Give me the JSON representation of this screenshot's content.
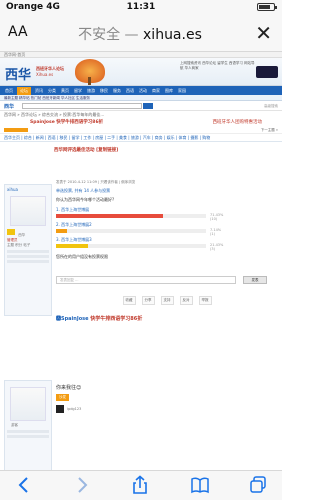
{
  "status_bar": {
    "carrier": "Orange  4G",
    "time": "11:31",
    "battery_level": 0.8
  },
  "safari": {
    "aa_label": "AA",
    "url_prefix": "不安全 — ",
    "url_domain": "xihua.es",
    "close_icon": "close-icon"
  },
  "site": {
    "topstrip": "西华网·首页",
    "logo": "西华",
    "logo_sub": "西班牙华人论坛",
    "logo_sub2": "Xihua.es",
    "banner_links": "上网搜索资讯  西华论坛  留学生  西语学习  网站导航  华人商家",
    "nav": [
      "首页",
      "论坛",
      "资讯",
      "分类",
      "黄页",
      "留学",
      "旅游",
      "移民",
      "服务",
      "西语",
      "活动",
      "商家",
      "图库",
      "家园"
    ],
    "subnav": "最新主题  精华帖  热门帖  西班牙新闻  华人社区  生活服务",
    "search_brand": "西华",
    "search_right": "高级搜索"
  },
  "breadcrumb": "西华网 » 西华论坛 » 综合交流 » 投票:西华每年的最佳…",
  "ads": {
    "left": "SpainJose 快学牛排西语学习86折",
    "right": "西班牙华人团购特惠活动"
  },
  "pager_right": "下一主题 »",
  "category_links": "西华主页 | 综合 | 新闻 | 西语 | 移民 | 留学 | 工作 | 房屋 | 二手 | 美食 | 旅游 | 汽车 | 商务 | 娱乐 | 体育 | 摄影 | 购物",
  "thread": {
    "title": "西华网评选最佳活动 [复制链接]",
    "meta": "发表于 2010-4-12 11:09 | 只看该作者 | 倒序浏览",
    "poll_title": "单选投票, 共有 14 人参与投票",
    "question": "你认为西华网今年哪个活动最好?",
    "options": [
      {
        "label": "1. 西华上海世博展",
        "percent": 71.43,
        "votes": 10,
        "color": "#e74c3c",
        "value_text": "71.43% (10)"
      },
      {
        "label": "2. 西华上海世博展2",
        "percent": 7.14,
        "votes": 1,
        "color": "#f39c12",
        "value_text": "7.14% (1)"
      },
      {
        "label": "3. 西华上海世博展3",
        "percent": 21.43,
        "votes": 3,
        "color": "#f1c40f",
        "value_text": "21.43% (3)"
      }
    ],
    "vote_note": "您所在的用户组没有投票权限",
    "reply_placeholder": "发表回复 ...",
    "reply_button": "发表",
    "actions": [
      "收藏",
      "分享",
      "支持",
      "反对",
      "举报"
    ],
    "signature_prefix": "🅰SpainJose",
    "signature_text": " 快学牛排西语学习86折"
  },
  "author": {
    "name": "xihua",
    "badge_text": "西华",
    "role": "管理员",
    "stats": "主题 积分 帖子"
  },
  "reply": {
    "text": "你来我往😊",
    "tag": "沙发",
    "user": "ipdg123",
    "author_name": "游客"
  },
  "toolbar": {
    "icons": [
      "back-icon",
      "forward-icon",
      "share-icon",
      "bookmarks-icon",
      "tabs-icon"
    ]
  }
}
